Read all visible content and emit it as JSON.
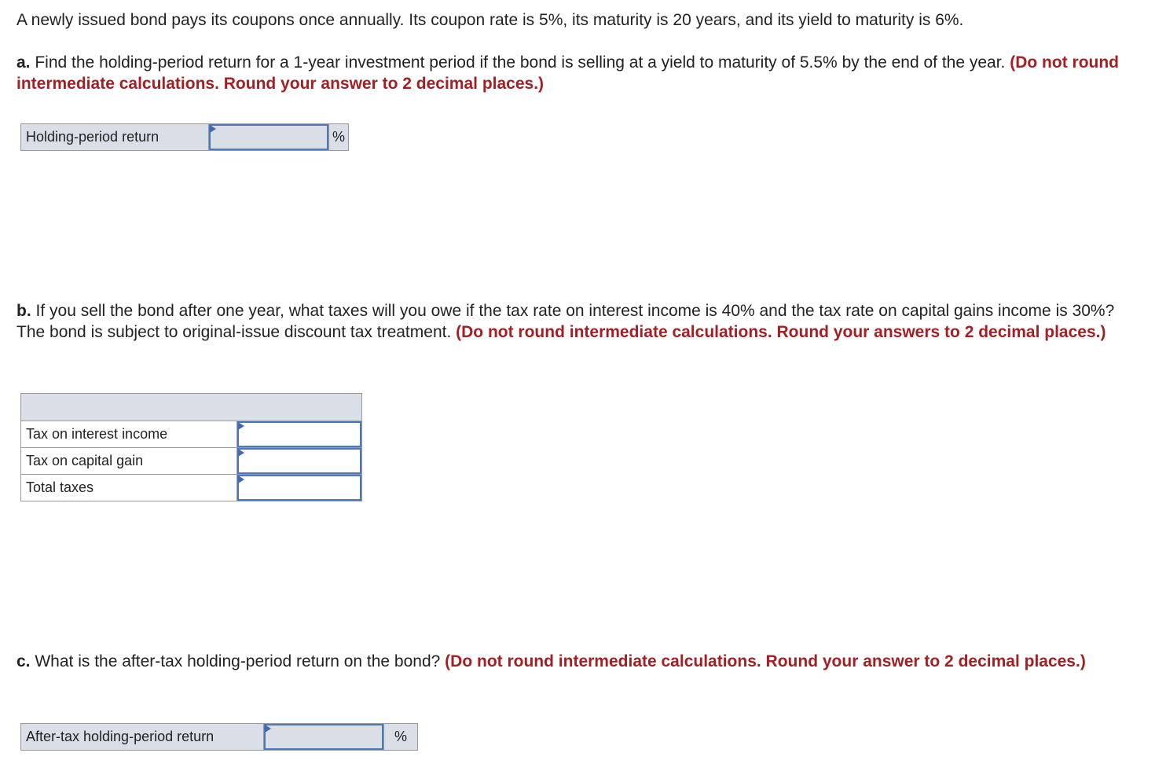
{
  "intro": "A newly issued bond pays its coupons once annually. Its coupon rate is 5%, its maturity is 20 years, and its yield to maturity is 6%.",
  "part_a": {
    "letter": "a.",
    "question": " Find the holding-period return for a 1-year investment period if the bond is selling at a yield to maturity of 5.5% by the end of the year. ",
    "instruction": "(Do not round intermediate calculations. Round your answer to 2 decimal places.)",
    "row_label": "Holding-period return",
    "value": "",
    "unit": "%"
  },
  "part_b": {
    "letter": "b.",
    "question": " If you sell the bond after one year, what taxes will you owe if the tax rate on interest income is 40% and the tax rate on capital gains income is 30%? The bond is subject to original-issue discount tax treatment. ",
    "instruction": "(Do not round intermediate calculations. Round your answers to 2 decimal places.)",
    "header": "",
    "rows": [
      {
        "label": "Tax on interest income",
        "value": ""
      },
      {
        "label": "Tax on capital gain",
        "value": ""
      },
      {
        "label": "Total taxes",
        "value": ""
      }
    ]
  },
  "part_c": {
    "letter": "c.",
    "question": " What is the after-tax holding-period return on the bond? ",
    "instruction": "(Do not round intermediate calculations. Round your answer to 2 decimal places.)",
    "row_label": "After-tax holding-period return",
    "value": "",
    "unit": "%"
  }
}
